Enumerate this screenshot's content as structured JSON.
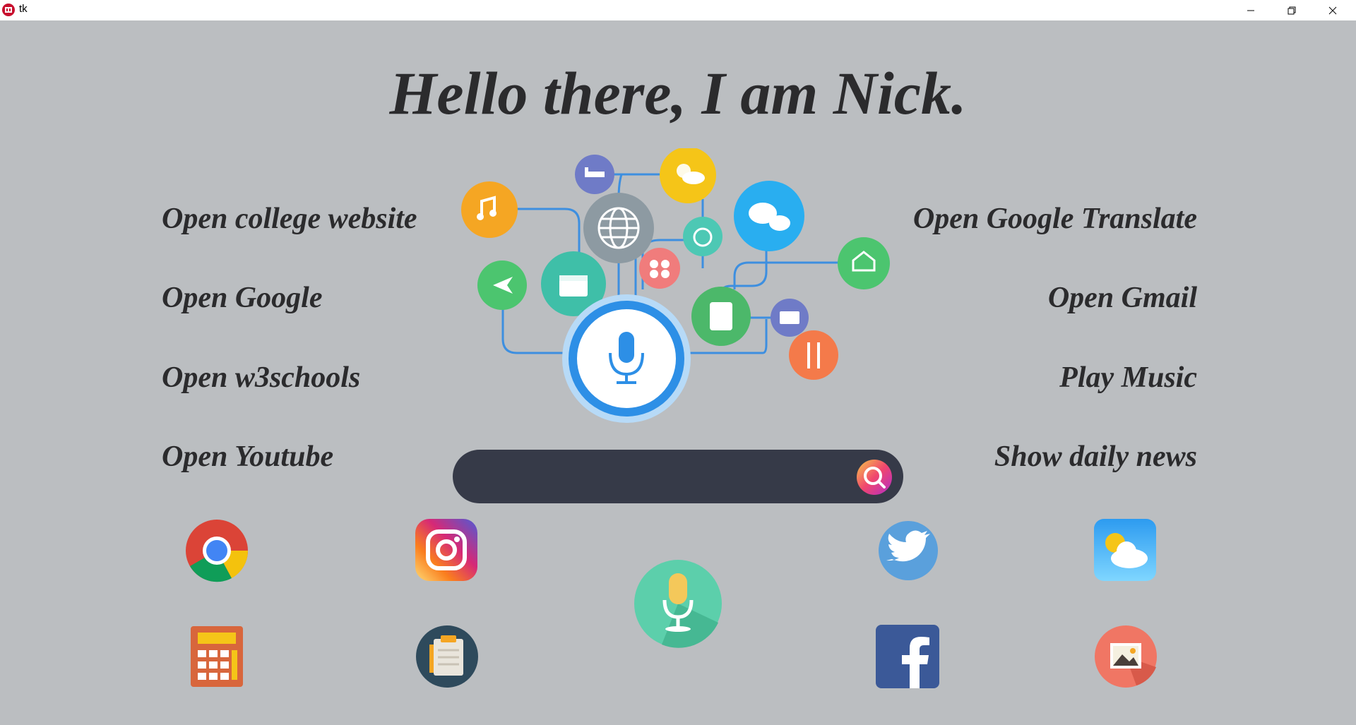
{
  "window": {
    "title": "tk"
  },
  "heading": "Hello there, I am Nick.",
  "commands": {
    "left": [
      "Open college website",
      "Open Google",
      "Open w3schools",
      "Open Youtube"
    ],
    "right": [
      "Open Google Translate",
      "Open Gmail",
      "Play Music",
      "Show daily news"
    ]
  },
  "search": {
    "value": "",
    "placeholder": "",
    "icon": "search-icon"
  },
  "app_icons": [
    "chrome-icon",
    "instagram-icon",
    "twitter-icon",
    "weather-icon",
    "calculator-icon",
    "notepad-icon",
    "voice-mic-icon",
    "facebook-icon",
    "gallery-icon"
  ],
  "colors": {
    "background": "#bbbec1",
    "search_bar": "#363a48",
    "text": "#2b2b2d",
    "mic_blue": "#2d8fe6"
  }
}
